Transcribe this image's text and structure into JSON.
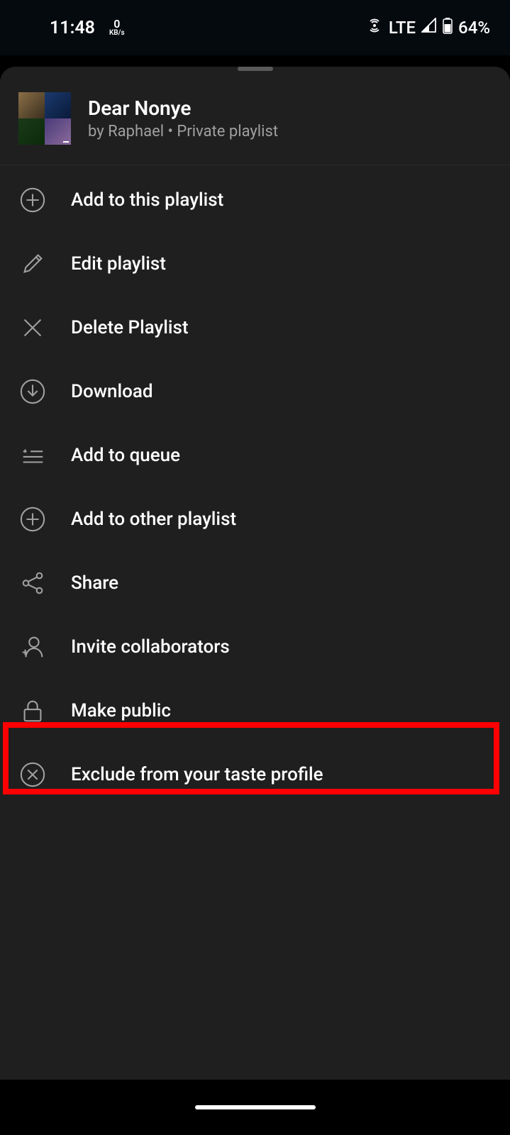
{
  "status": {
    "time": "11:48",
    "speed_value": "0",
    "speed_unit": "KB/s",
    "network": "LTE",
    "battery": "64%"
  },
  "playlist": {
    "title": "Dear Nonye",
    "subtitle": "by Raphael • Private playlist"
  },
  "menu": {
    "add_to_this": "Add to this playlist",
    "edit": "Edit playlist",
    "delete": "Delete Playlist",
    "download": "Download",
    "queue": "Add to queue",
    "add_other": "Add to other playlist",
    "share": "Share",
    "invite": "Invite collaborators",
    "public": "Make public",
    "exclude": "Exclude from your taste profile"
  }
}
